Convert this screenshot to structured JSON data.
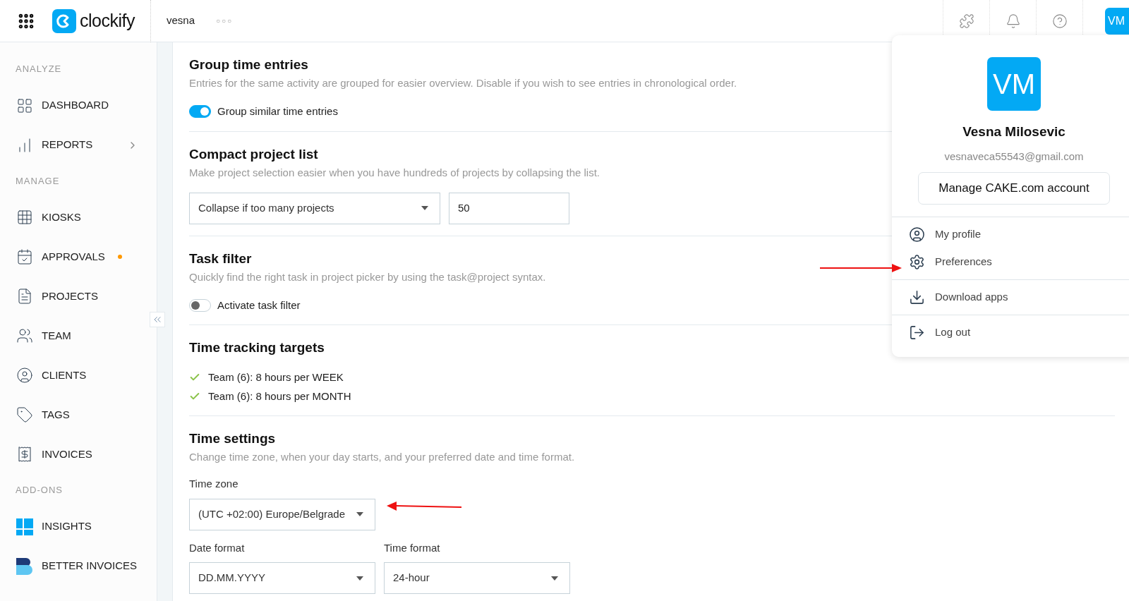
{
  "header": {
    "logo": "clockify",
    "workspace": "vesna",
    "more": "○○○",
    "avatar": "VM"
  },
  "sidebar": {
    "sections": [
      {
        "label": "ANALYZE",
        "items": [
          {
            "label": "DASHBOARD",
            "selected": false,
            "submenu": false,
            "notification": false
          },
          {
            "label": "REPORTS",
            "selected": false,
            "submenu": true,
            "notification": false
          }
        ]
      },
      {
        "label": "MANAGE",
        "items": [
          {
            "label": "KIOSKS",
            "selected": false,
            "submenu": false,
            "notification": false
          },
          {
            "label": "APPROVALS",
            "selected": false,
            "submenu": false,
            "notification": true
          },
          {
            "label": "PROJECTS",
            "selected": false,
            "submenu": false,
            "notification": false
          },
          {
            "label": "TEAM",
            "selected": false,
            "submenu": false,
            "notification": false
          },
          {
            "label": "CLIENTS",
            "selected": false,
            "submenu": false,
            "notification": false
          },
          {
            "label": "TAGS",
            "selected": false,
            "submenu": false,
            "notification": false
          },
          {
            "label": "INVOICES",
            "selected": false,
            "submenu": false,
            "notification": false
          }
        ]
      },
      {
        "label": "ADD-ONS",
        "items": [
          {
            "label": "INSIGHTS",
            "selected": false,
            "submenu": false,
            "notification": false
          },
          {
            "label": "BETTER INVOICES",
            "selected": false,
            "submenu": false,
            "notification": false
          }
        ]
      }
    ]
  },
  "settings": [
    {
      "kind": "toggle",
      "title": "Group time entries",
      "description": "Entries for the same activity are grouped for easier overview. Disable if you wish to see entries in chronological order.",
      "toggle": {
        "label": "Group similar time entries",
        "on": true
      }
    },
    {
      "kind": "select",
      "title": "Compact project list",
      "description": "Make project selection easier when you have hundreds of projects by collapsing the list.",
      "select": {
        "value": "Collapse if too many projects"
      },
      "input": {
        "value": "50"
      }
    },
    {
      "kind": "toggle",
      "title": "Task filter",
      "description": "Quickly find the right task in project picker by using the task@project syntax.",
      "toggle": {
        "label": "Activate task filter",
        "on": false
      }
    },
    {
      "kind": "targets",
      "title": "Time tracking targets",
      "targets": [
        "Team (6): 8 hours per WEEK",
        "Team (6): 8 hours per MONTH"
      ]
    },
    {
      "kind": "fields",
      "title": "Time settings",
      "description": "Change time zone, when your day starts, and your preferred date and time format.",
      "rows": [
        [
          {
            "label": "Time zone",
            "value": "(UTC +02:00) Europe/Belgrade"
          }
        ],
        [
          {
            "label": "Date format",
            "value": "DD.MM.YYYY"
          },
          {
            "label": "Time format",
            "value": "24-hour"
          }
        ]
      ]
    }
  ],
  "user_menu": {
    "avatar": "VM",
    "name": "Vesna Milosevic",
    "email": "vesnaveca55543@gmail.com",
    "manage_button": "Manage CAKE.com account",
    "groups": [
      [
        "My profile",
        "Preferences"
      ],
      [
        "Download apps"
      ],
      [
        "Log out"
      ]
    ]
  }
}
